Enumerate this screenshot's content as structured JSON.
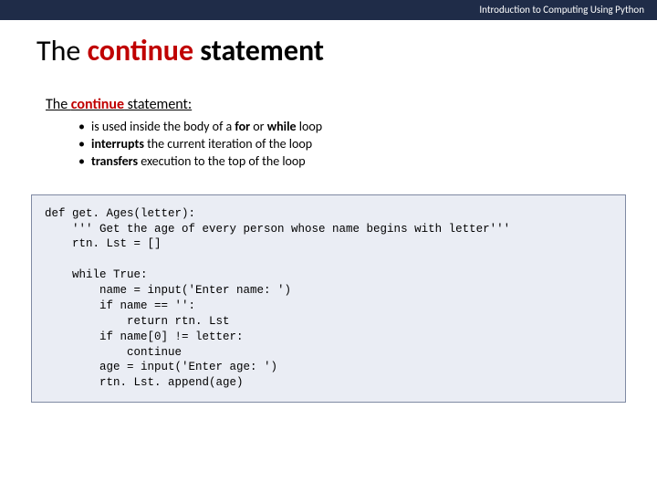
{
  "header": {
    "course": "Introduction to Computing Using Python"
  },
  "title": {
    "prefix": "The ",
    "keyword": "continue",
    "suffix": " statement"
  },
  "subheading": {
    "prefix": "The ",
    "keyword": "continue",
    "suffix": " statement:"
  },
  "bullets": {
    "b1_pre": "is used inside the body of a ",
    "b1_kw1": "for",
    "b1_mid": " or ",
    "b1_kw2": "while",
    "b1_post": " loop",
    "b2_kw": "interrupts",
    "b2_post": " the current iteration of the loop",
    "b3_kw": "transfers",
    "b3_post": " execution to the top of the loop"
  },
  "code": "def get. Ages(letter):\n    ''' Get the age of every person whose name begins with letter'''\n    rtn. Lst = []\n\n    while True:\n        name = input('Enter name: ')\n        if name == '':\n            return rtn. Lst\n        if name[0] != letter:\n            continue\n        age = input('Enter age: ')\n        rtn. Lst. append(age)"
}
